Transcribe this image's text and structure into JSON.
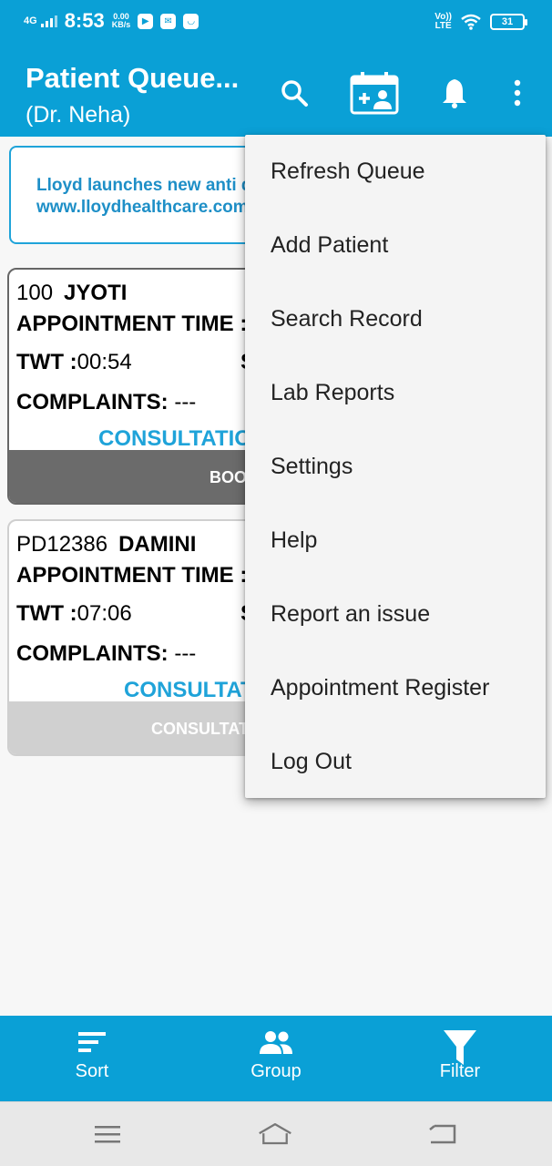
{
  "status_bar": {
    "network": "4G",
    "time": "8:53",
    "speed_value": "0.00",
    "speed_unit": "KB/s",
    "volte": "Vo))",
    "lte": "LTE",
    "battery": "31"
  },
  "app_bar": {
    "title": "Patient Queue...",
    "subtitle": "(Dr. Neha)"
  },
  "banner": {
    "line1": "Lloyd launches new anti d",
    "line2": "www.lloydhealthcare.com"
  },
  "cards": [
    {
      "id": "100",
      "name": "JYOTI",
      "appointment_label": "APPOINTMENT TIME :",
      "twt_label": "TWT :",
      "twt_value": "00:54",
      "twt_suffix": "S",
      "complaints_label": "COMPLAINTS:",
      "complaints_value": " ---",
      "consult_label": "CONSULTATIO",
      "footer_label": "BOO"
    },
    {
      "id": "PD12386",
      "name": "DAMINI",
      "appointment_label": "APPOINTMENT TIME :",
      "twt_label": "TWT :",
      "twt_value": "07:06",
      "twt_suffix": "S",
      "complaints_label": "COMPLAINTS:",
      "complaints_value": " ---",
      "consult_label": "CONSULTAT",
      "footer_label": "CONSULTAT"
    }
  ],
  "menu": {
    "items": [
      "Refresh Queue",
      "Add Patient",
      "Search Record",
      "Lab Reports",
      "Settings",
      "Help",
      "Report an issue",
      "Appointment Register",
      "Log Out"
    ]
  },
  "bottom_bar": {
    "sort": "Sort",
    "group": "Group",
    "filter": "Filter"
  },
  "colors": {
    "primary": "#0aa0d6",
    "accent_text": "#1fa3d9",
    "menu_bg": "#f4f4f4"
  }
}
